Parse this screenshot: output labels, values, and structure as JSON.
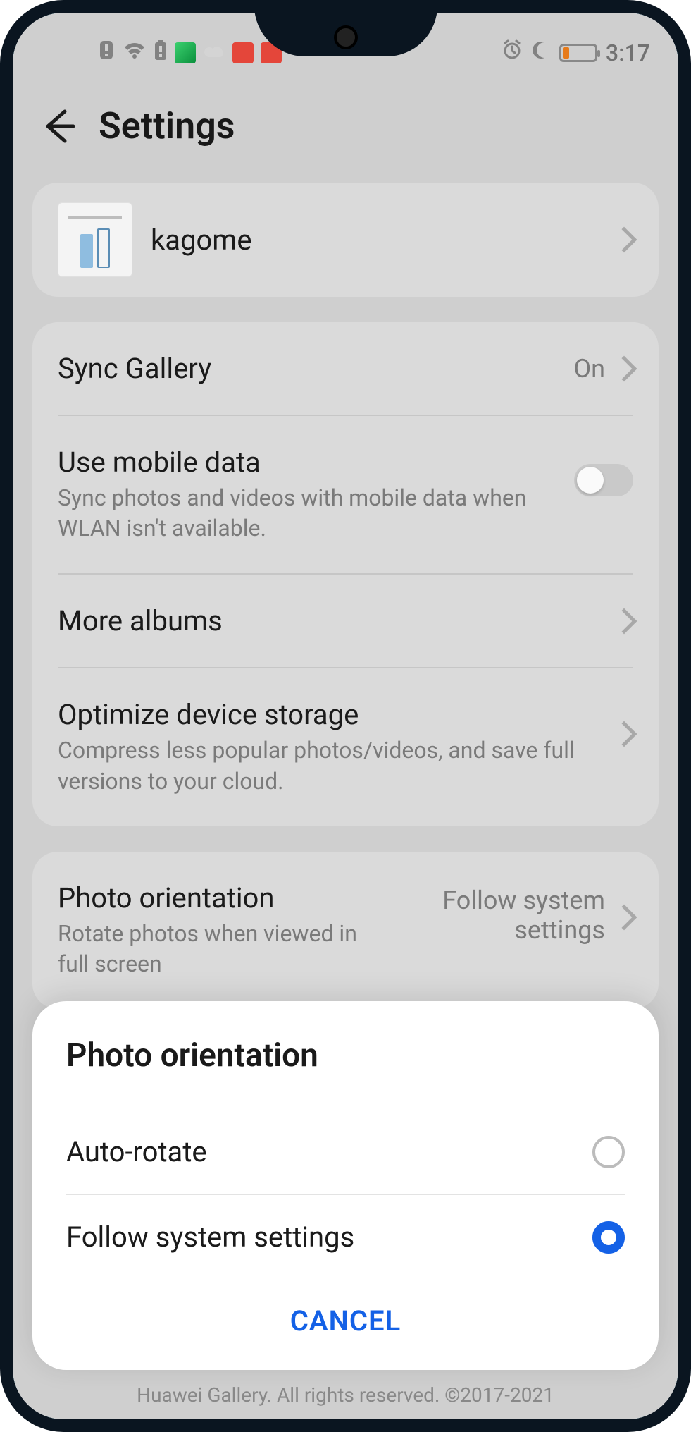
{
  "status": {
    "time": "3:17"
  },
  "header": {
    "title": "Settings"
  },
  "profile": {
    "name": "kagome"
  },
  "sync": {
    "label": "Sync Gallery",
    "value": "On"
  },
  "mobile_data": {
    "label": "Use mobile data",
    "sub": "Sync photos and videos with mobile data when WLAN isn't available."
  },
  "more_albums": {
    "label": "More albums"
  },
  "optimize": {
    "label": "Optimize device storage",
    "sub": "Compress less popular photos/videos, and save full versions to your cloud."
  },
  "orientation": {
    "label": "Photo orientation",
    "sub": "Rotate photos when viewed in full screen",
    "value": "Follow system settings"
  },
  "dialog": {
    "title": "Photo orientation",
    "options": [
      {
        "label": "Auto-rotate",
        "selected": false
      },
      {
        "label": "Follow system settings",
        "selected": true
      }
    ],
    "cancel": "CANCEL"
  },
  "footer": "Huawei Gallery. All rights reserved. ©2017-2021"
}
